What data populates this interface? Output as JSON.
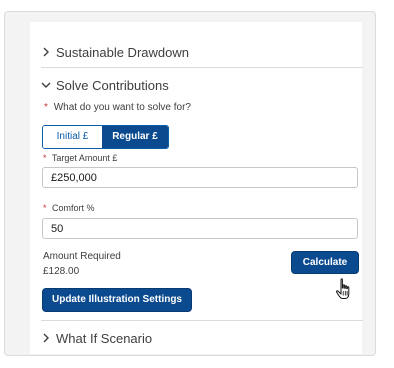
{
  "sections": {
    "drawdown": {
      "title": "Sustainable Drawdown",
      "expanded": false
    },
    "solve": {
      "title": "Solve Contributions",
      "expanded": true
    },
    "what_if": {
      "title": "What If Scenario",
      "expanded": false
    }
  },
  "solve_for": {
    "required_mark": "*",
    "label": "What do you want to solve for?",
    "options": [
      "Initial £",
      "Regular £"
    ],
    "selected": "Regular £"
  },
  "target_amount": {
    "required_mark": "*",
    "label": "Target Amount £",
    "value": "£250,000"
  },
  "comfort": {
    "required_mark": "*",
    "label": "Comfort %",
    "value": "50"
  },
  "result": {
    "label": "Amount Required",
    "value": "£128.00"
  },
  "buttons": {
    "calculate": "Calculate",
    "update": "Update Illustration Settings"
  },
  "colors": {
    "accent": "#0b4a8f",
    "required": "#c23934",
    "border": "#dddbda"
  },
  "icons": {
    "collapsed": "chevron-right-icon",
    "expanded": "chevron-down-icon",
    "pointer": "hand-pointer-icon"
  }
}
